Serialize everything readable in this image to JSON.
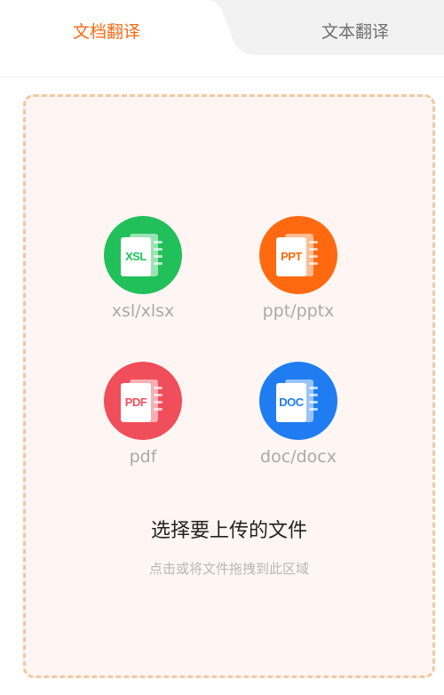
{
  "tabs": [
    {
      "label": "文档翻译",
      "active": true
    },
    {
      "label": "文本翻译",
      "active": false
    }
  ],
  "colors": {
    "accent": "#ff6a13",
    "dropzone_bg": "#fff6f3",
    "dropzone_border": "#f0c9a4",
    "xls": "#22c05a",
    "ppt": "#ff6a10",
    "pdf": "#f04e5a",
    "doc": "#1f7df1"
  },
  "file_types": [
    {
      "icon": "xls-file-icon",
      "badge": "XSL",
      "label": "xsl/xlsx"
    },
    {
      "icon": "ppt-file-icon",
      "badge": "PPT",
      "label": "ppt/pptx"
    },
    {
      "icon": "pdf-file-icon",
      "badge": "PDF",
      "label": "pdf"
    },
    {
      "icon": "doc-file-icon",
      "badge": "DOC",
      "label": "doc/docx"
    }
  ],
  "upload": {
    "title": "选择要上传的文件",
    "hint": "点击或将文件拖拽到此区域"
  }
}
